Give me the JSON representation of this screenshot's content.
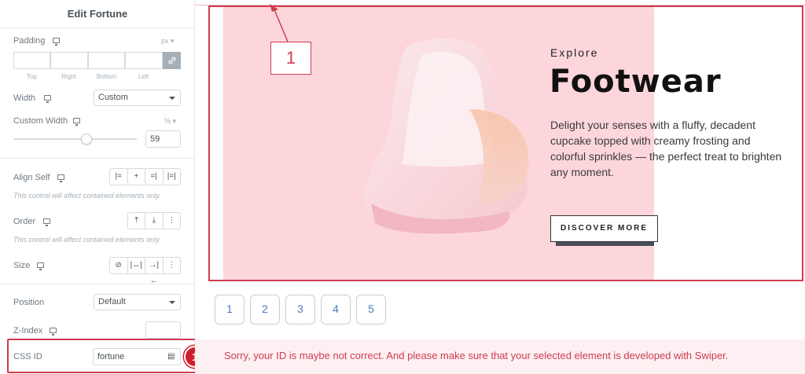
{
  "panel": {
    "title": "Edit Fortune"
  },
  "padding": {
    "label": "Padding",
    "unit": "px",
    "sides": [
      "Top",
      "Right",
      "Bottom",
      "Left"
    ]
  },
  "width": {
    "label": "Width",
    "value": "Custom"
  },
  "custom_width": {
    "label": "Custom Width",
    "unit": "%",
    "value": "59",
    "slider_fraction": 0.59
  },
  "align_self": {
    "label": "Align Self",
    "note": "This control will affect contained elements only."
  },
  "order": {
    "label": "Order",
    "note": "This control will affect contained elements only."
  },
  "size": {
    "label": "Size"
  },
  "position": {
    "label": "Position",
    "value": "Default"
  },
  "z_index": {
    "label": "Z-Index",
    "value": ""
  },
  "css_id": {
    "label": "CSS ID",
    "value": "fortune"
  },
  "badge": {
    "number": "1"
  },
  "callout": {
    "number": "1"
  },
  "slide": {
    "eyebrow": "Explore",
    "heading": "Footwear",
    "description": "Delight your senses with a fluffy, decadent cupcake topped with creamy frosting and colorful sprinkles — the perfect treat to brighten any moment.",
    "cta": "DISCOVER MORE"
  },
  "pagination": [
    "1",
    "2",
    "3",
    "4",
    "5"
  ],
  "error": {
    "message": "Sorry, your ID is maybe not correct. And please make sure that your selected element is developed with Swiper."
  },
  "colors": {
    "accent_red": "#d03c4e",
    "slide_bg": "#fdd6dc",
    "link_blue": "#4a7bc1"
  }
}
